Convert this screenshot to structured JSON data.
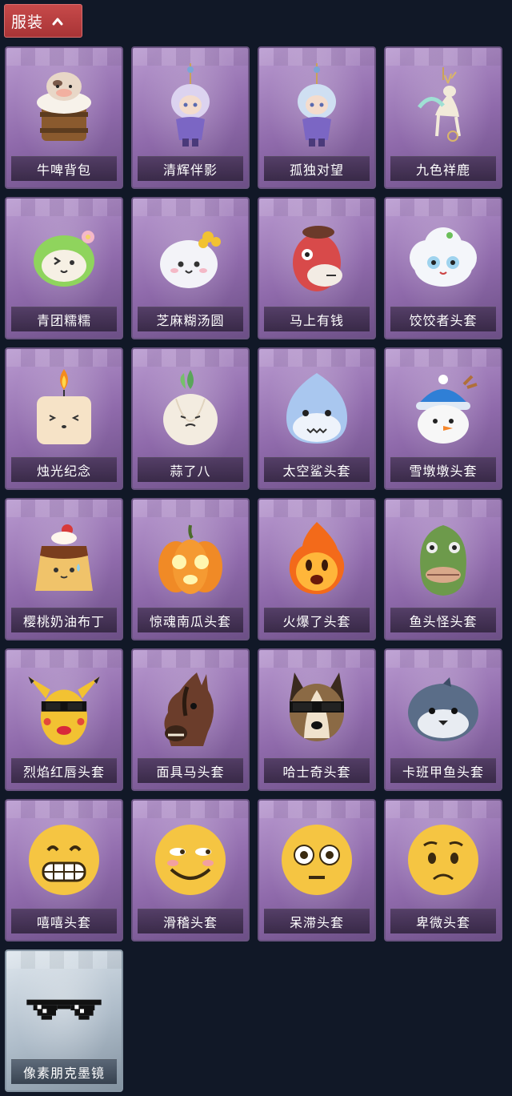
{
  "header": {
    "tab_label": "服装",
    "toggle_icon": "chevron-up-icon"
  },
  "items": [
    {
      "label": "牛啤背包",
      "icon": "cow-beer-barrel-icon",
      "color": "#e8d7c7"
    },
    {
      "label": "清辉伴影",
      "icon": "white-hair-figure-charm-icon",
      "color": "#dcd3f0"
    },
    {
      "label": "孤独对望",
      "icon": "blue-figure-charm-icon",
      "color": "#cfdff2"
    },
    {
      "label": "九色祥鹿",
      "icon": "deer-charm-icon",
      "color": "#f2ead9"
    },
    {
      "label": "青团糯糯",
      "icon": "green-dumpling-icon",
      "color": "#8fd45d"
    },
    {
      "label": "芝麻糊汤圆",
      "icon": "rice-ball-icon",
      "color": "#f3f3f8"
    },
    {
      "label": "马上有钱",
      "icon": "red-horse-mask-icon",
      "color": "#d84a4a"
    },
    {
      "label": "饺饺者头套",
      "icon": "white-cloud-head-icon",
      "color": "#f4f6fa"
    },
    {
      "label": "烛光纪念",
      "icon": "candle-icon",
      "color": "#f6e3c7"
    },
    {
      "label": "蒜了八",
      "icon": "garlic-icon",
      "color": "#f3ece0"
    },
    {
      "label": "太空鲨头套",
      "icon": "shark-head-icon",
      "color": "#a9c7ef"
    },
    {
      "label": "雪墩墩头套",
      "icon": "snowman-head-icon",
      "color": "#f7f7f7"
    },
    {
      "label": "樱桃奶油布丁",
      "icon": "pudding-icon",
      "color": "#f0c36a"
    },
    {
      "label": "惊魂南瓜头套",
      "icon": "pumpkin-head-icon",
      "color": "#f08a26"
    },
    {
      "label": "火爆了头套",
      "icon": "fire-head-icon",
      "color": "#f36a1a"
    },
    {
      "label": "鱼头怪头套",
      "icon": "fish-head-icon",
      "color": "#6d9a4b"
    },
    {
      "label": "烈焰红唇头套",
      "icon": "yellow-mouse-head-icon",
      "color": "#f2c232"
    },
    {
      "label": "面具马头套",
      "icon": "horse-head-mask-icon",
      "color": "#6b3d2b"
    },
    {
      "label": "哈士奇头套",
      "icon": "dog-head-icon",
      "color": "#8b6a45"
    },
    {
      "label": "卡班甲鱼头套",
      "icon": "fish-face-head-icon",
      "color": "#5a6d88"
    },
    {
      "label": "嘻嘻头套",
      "icon": "grin-emoji-head-icon",
      "color": "#f5c542"
    },
    {
      "label": "滑稽头套",
      "icon": "smug-emoji-head-icon",
      "color": "#f5c542"
    },
    {
      "label": "呆滞头套",
      "icon": "flushed-emoji-head-icon",
      "color": "#f5c542"
    },
    {
      "label": "卑微头套",
      "icon": "pleading-emoji-head-icon",
      "color": "#f5c542"
    },
    {
      "label": "像素朋克墨镜",
      "icon": "pixel-sunglasses-icon",
      "color": "#111111",
      "rarity": "silver"
    }
  ]
}
